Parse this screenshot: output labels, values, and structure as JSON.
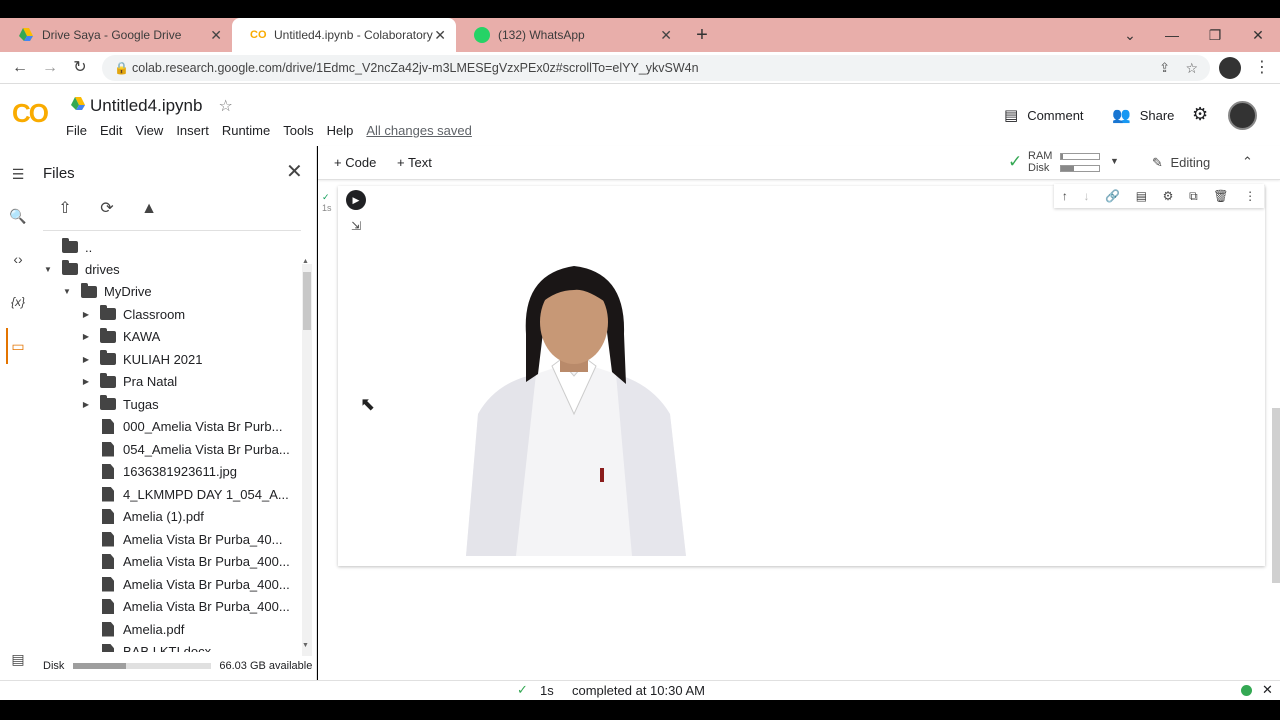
{
  "browser": {
    "tabs": [
      {
        "title": "Drive Saya - Google Drive",
        "active": false,
        "icon": "google-drive-icon"
      },
      {
        "title": "Untitled4.ipynb - Colaboratory",
        "active": true,
        "icon": "colab-icon"
      },
      {
        "title": "(132) WhatsApp",
        "active": false,
        "icon": "whatsapp-icon"
      }
    ],
    "url": "colab.research.google.com/drive/1Edmc_V2ncZa42jv-m3LMESEgVzxPEx0z#scrollTo=elYY_ykvSW4n"
  },
  "colab": {
    "logo": "CO",
    "notebook_title": "Untitled4.ipynb",
    "menu": [
      "File",
      "Edit",
      "View",
      "Insert",
      "Runtime",
      "Tools",
      "Help"
    ],
    "save_status": "All changes saved",
    "comment_label": "Comment",
    "share_label": "Share"
  },
  "toolbar": {
    "add_code": "Code",
    "add_text": "Text",
    "ram_label": "RAM",
    "disk_label": "Disk",
    "ram_usage": 0.05,
    "disk_usage": 0.35,
    "mode_label": "Editing"
  },
  "files_panel": {
    "title": "Files",
    "parent": "..",
    "tree": [
      {
        "name": "drives",
        "type": "folder",
        "depth": 0,
        "expanded": true
      },
      {
        "name": "MyDrive",
        "type": "folder",
        "depth": 1,
        "expanded": true
      },
      {
        "name": "Classroom",
        "type": "folder",
        "depth": 2,
        "expanded": false
      },
      {
        "name": "KAWA",
        "type": "folder",
        "depth": 2,
        "expanded": false
      },
      {
        "name": "KULIAH 2021",
        "type": "folder",
        "depth": 2,
        "expanded": false
      },
      {
        "name": "Pra Natal",
        "type": "folder",
        "depth": 2,
        "expanded": false
      },
      {
        "name": "Tugas",
        "type": "folder",
        "depth": 2,
        "expanded": false
      },
      {
        "name": "000_Amelia Vista Br Purb...",
        "type": "file",
        "depth": 2
      },
      {
        "name": "054_Amelia Vista Br Purba...",
        "type": "file",
        "depth": 2
      },
      {
        "name": "1636381923611.jpg",
        "type": "file",
        "depth": 2
      },
      {
        "name": "4_LKMMPD DAY 1_054_A...",
        "type": "file",
        "depth": 2
      },
      {
        "name": "Amelia (1).pdf",
        "type": "file",
        "depth": 2
      },
      {
        "name": "Amelia Vista Br Purba_40...",
        "type": "file",
        "depth": 2
      },
      {
        "name": "Amelia Vista Br Purba_400...",
        "type": "file",
        "depth": 2
      },
      {
        "name": "Amelia Vista Br Purba_400...",
        "type": "file",
        "depth": 2
      },
      {
        "name": "Amelia Vista Br Purba_400...",
        "type": "file",
        "depth": 2
      },
      {
        "name": "Amelia.pdf",
        "type": "file",
        "depth": 2
      },
      {
        "name": "BAB I KTI.docx",
        "type": "file",
        "depth": 2
      }
    ],
    "disk_label": "Disk",
    "disk_used_fraction": 0.38,
    "disk_available": "66.03 GB available"
  },
  "cell": {
    "exec_marker": "1s"
  },
  "status_bar": {
    "duration": "1s",
    "message": "completed at 10:30 AM"
  },
  "colors": {
    "tabstrip": "#e8aeaa",
    "colab_orange": "#f9ab00",
    "colab_dark_orange": "#e37400",
    "ok_green": "#34a853"
  }
}
